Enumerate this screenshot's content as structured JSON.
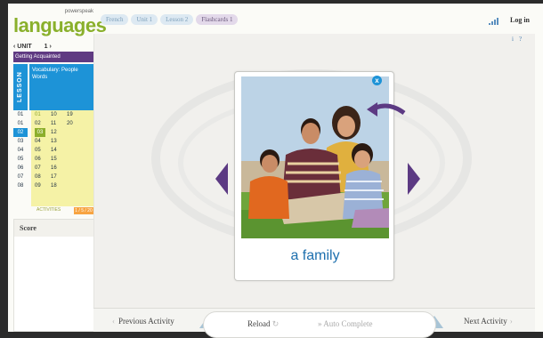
{
  "header": {
    "logo_sub": "powerspeak",
    "logo_main": "languages",
    "breadcrumbs": [
      "French",
      "Unit 1",
      "Lesson 2",
      "Flashcards 1"
    ],
    "login_label": "Log in",
    "info_label": "i",
    "help_label": "?"
  },
  "sidebar": {
    "unit_prev": "‹ UNIT",
    "unit_num": "1 ›",
    "unit_title": "Getting Acquainted",
    "lesson_tab": "LESSON",
    "lesson_title": "Vocabulary: People Words",
    "lessons": [
      "01",
      "01",
      "02",
      "03",
      "04",
      "05",
      "06",
      "07",
      "08"
    ],
    "selected_lesson_index": 2,
    "activity_rows": [
      [
        "01",
        "10",
        "19"
      ],
      [
        "02",
        "11",
        "20"
      ],
      [
        "03",
        "12",
        ""
      ],
      [
        "04",
        "13",
        ""
      ],
      [
        "05",
        "14",
        ""
      ],
      [
        "06",
        "15",
        ""
      ],
      [
        "07",
        "16",
        ""
      ],
      [
        "08",
        "17",
        ""
      ],
      [
        "09",
        "18",
        ""
      ]
    ],
    "selected_activity": "03",
    "activities_label": "ACTIVITIES",
    "activities_badge": "1 / 5 / 20",
    "score_title": "Score"
  },
  "card": {
    "word": "a family",
    "close_label": "x"
  },
  "bottom": {
    "prev_label": "Previous Activity",
    "reload_label": "Reload",
    "auto_label": "Auto Complete",
    "next_label": "Next Activity"
  },
  "colors": {
    "brand_green": "#8ab02c",
    "accent_purple": "#5c3a83",
    "accent_blue": "#1d93d7"
  }
}
